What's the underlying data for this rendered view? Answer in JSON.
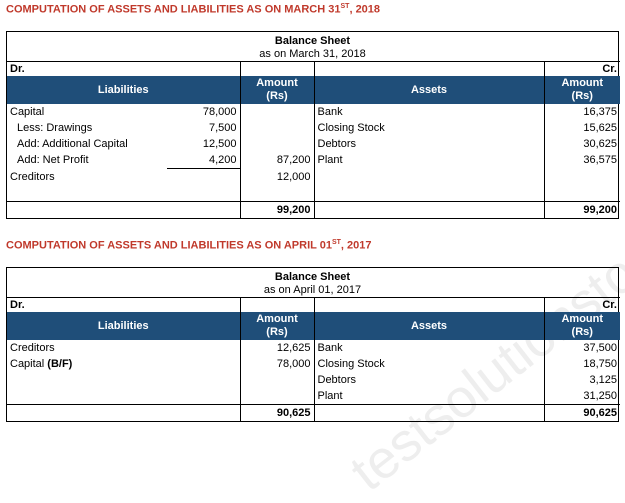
{
  "sections": [
    {
      "title_main": "COMPUTATION OF ASSETS AND LIABILITIES AS ON MARCH 31",
      "title_sup": "ST",
      "title_end": ", 2018",
      "sheet_title": "Balance Sheet",
      "sheet_date": "as on March 31, 2018",
      "dr": "Dr.",
      "cr": "Cr.",
      "headers": {
        "liabilities": "Liabilities",
        "amount": "Amount",
        "rs": "(Rs)",
        "assets": "Assets"
      },
      "rows": [
        {
          "l": "Capital",
          "lv": "78,000",
          "la": "",
          "a": "Bank",
          "aa": "16,375"
        },
        {
          "l": "Less: Drawings",
          "lv": "7,500",
          "la": "",
          "a": "Closing Stock",
          "aa": "15,625"
        },
        {
          "l": "Add: Additional Capital",
          "lv": "12,500",
          "la": "",
          "a": "Debtors",
          "aa": "30,625"
        },
        {
          "l": "Add: Net Profit",
          "lv": "4,200",
          "la": "87,200",
          "a": "Plant",
          "aa": "36,575"
        },
        {
          "l": "Creditors",
          "lv": "",
          "la": "12,000",
          "a": "",
          "aa": ""
        }
      ],
      "total_liab": "99,200",
      "total_assets": "99,200"
    },
    {
      "title_main": "COMPUTATION OF ASSETS AND LIABILITIES AS ON APRIL 01",
      "title_sup": "ST",
      "title_end": ", 2017",
      "sheet_title": "Balance Sheet",
      "sheet_date": "as on April 01, 2017",
      "dr": "Dr.",
      "cr": "Cr.",
      "headers": {
        "liabilities": "Liabilities",
        "amount": "Amount",
        "rs": "(Rs)",
        "assets": "Assets"
      },
      "rows": [
        {
          "l": "Creditors",
          "lb": "",
          "la": "12,625",
          "a": "Bank",
          "aa": "37,500"
        },
        {
          "l": "Capital ",
          "lb": "(B/F)",
          "la": "78,000",
          "a": "Closing Stock",
          "aa": "18,750"
        },
        {
          "l": "",
          "lb": "",
          "la": "",
          "a": "Debtors",
          "aa": "3,125"
        },
        {
          "l": "",
          "lb": "",
          "la": "",
          "a": "Plant",
          "aa": "31,250"
        }
      ],
      "total_liab": "90,625",
      "total_assets": "90,625"
    }
  ],
  "watermark": "testsolutionstoday.com"
}
